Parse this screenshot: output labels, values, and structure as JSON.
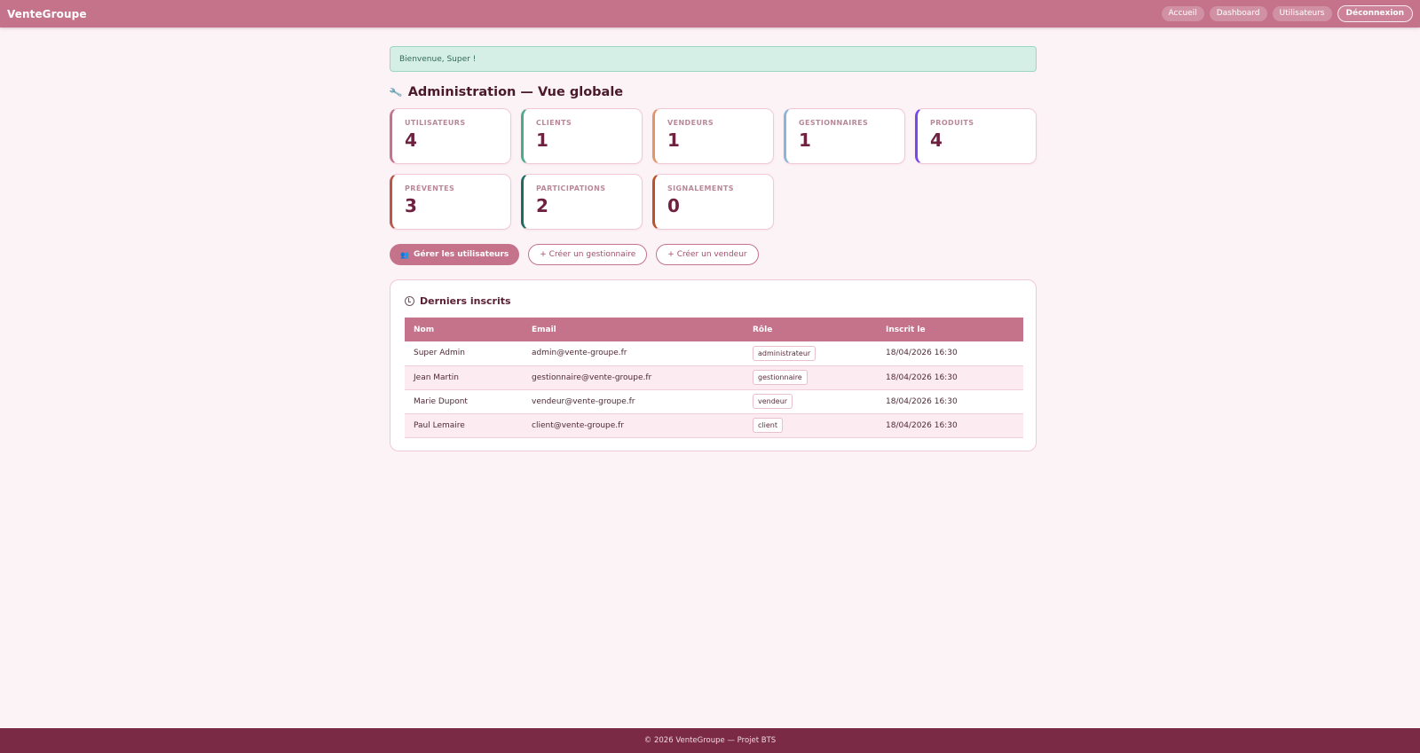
{
  "header": {
    "brand": "VenteGroupe",
    "nav": [
      "Accueil",
      "Dashboard",
      "Utilisateurs"
    ],
    "logout": "Déconnexion"
  },
  "alert": "Bienvenue, Super !",
  "page_title": "Administration — Vue globale",
  "stats": [
    {
      "label": "UTILISATEURS",
      "value": "4",
      "color": "#c5728b"
    },
    {
      "label": "CLIENTS",
      "value": "1",
      "color": "#4daa8e"
    },
    {
      "label": "VENDEURS",
      "value": "1",
      "color": "#e0976b"
    },
    {
      "label": "GESTIONNAIRES",
      "value": "1",
      "color": "#8eb4d8"
    },
    {
      "label": "PRODUITS",
      "value": "4",
      "color": "#7b47e8"
    },
    {
      "label": "PRÉVENTES",
      "value": "3",
      "color": "#b9574a"
    },
    {
      "label": "PARTICIPATIONS",
      "value": "2",
      "color": "#1e6b63"
    },
    {
      "label": "SIGNALEMENTS",
      "value": "0",
      "color": "#b7542a"
    }
  ],
  "actions": {
    "manage_users": "Gérer les utilisateurs",
    "create_manager": "+ Créer un gestionnaire",
    "create_seller": "+ Créer un vendeur"
  },
  "recent": {
    "title": "Derniers inscrits",
    "columns": [
      "Nom",
      "Email",
      "Rôle",
      "Inscrit le"
    ],
    "rows": [
      {
        "name": "Super Admin",
        "email": "admin@vente-groupe.fr",
        "role": "administrateur",
        "date": "18/04/2026 16:30"
      },
      {
        "name": "Jean Martin",
        "email": "gestionnaire@vente-groupe.fr",
        "role": "gestionnaire",
        "date": "18/04/2026 16:30"
      },
      {
        "name": "Marie Dupont",
        "email": "vendeur@vente-groupe.fr",
        "role": "vendeur",
        "date": "18/04/2026 16:30"
      },
      {
        "name": "Paul Lemaire",
        "email": "client@vente-groupe.fr",
        "role": "client",
        "date": "18/04/2026 16:30"
      }
    ]
  },
  "footer": "© 2026 VenteGroupe — Projet BTS"
}
